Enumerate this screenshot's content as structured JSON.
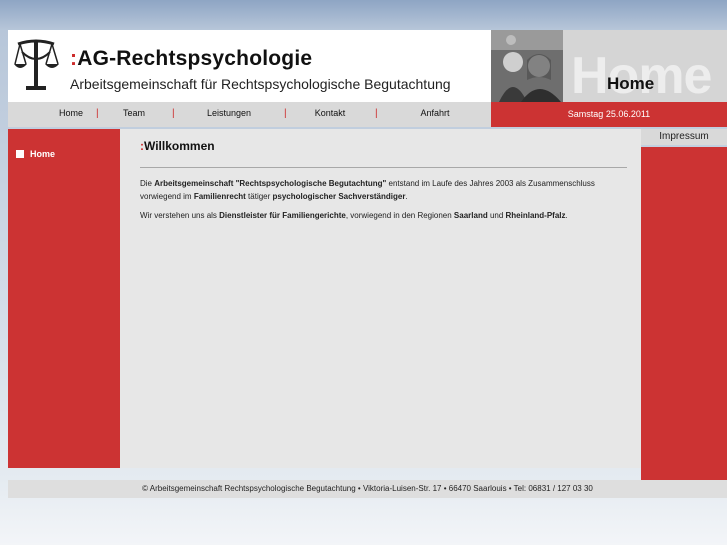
{
  "header": {
    "title_colon": ":",
    "title": "AG-Rechtspsychologie",
    "subtitle": "Arbeitsgemeinschaft für Rechtspsychologische Begutachtung",
    "home_ghost": "Home",
    "home_label": "Home"
  },
  "nav": {
    "items": [
      {
        "label": "Home"
      },
      {
        "label": "Team"
      },
      {
        "label": "Leistungen"
      },
      {
        "label": "Kontakt"
      },
      {
        "label": "Anfahrt"
      }
    ],
    "separator": "|"
  },
  "date": "Samstag 25.06.2011",
  "sidebar": {
    "items": [
      {
        "label": "Home"
      }
    ]
  },
  "impressum": "Impressum",
  "content": {
    "title_colon": ":",
    "title": "Willkommen",
    "p1": {
      "t1": "Die ",
      "b1": "Arbeitsgemeinschaft \"Rechtspsychologische Begutachtung\"",
      "t2": " entstand im Laufe des Jahres 2003 als Zusammenschluss vorwiegend im ",
      "b2": "Familienrecht",
      "t3": " tätiger ",
      "b3": "psychologischer Sachverständiger",
      "t4": "."
    },
    "p2": {
      "t1": "Wir verstehen uns als ",
      "b1": "Dienstleister für Familiengerichte",
      "t2": ", vorwiegend in den Regionen ",
      "b2": "Saarland",
      "t3": " und ",
      "b3": "Rheinland-Pfalz",
      "t4": "."
    }
  },
  "footer": "© Arbeitsgemeinschaft Rechtspsychologische Begutachtung • Viktoria-Luisen-Str. 17 • 66470 Saarlouis • Tel: 06831 / 127 03 30",
  "colors": {
    "accent_red": "#cc3333",
    "nav_gray": "#d9d9d9",
    "content_gray": "#e7e7e7"
  }
}
